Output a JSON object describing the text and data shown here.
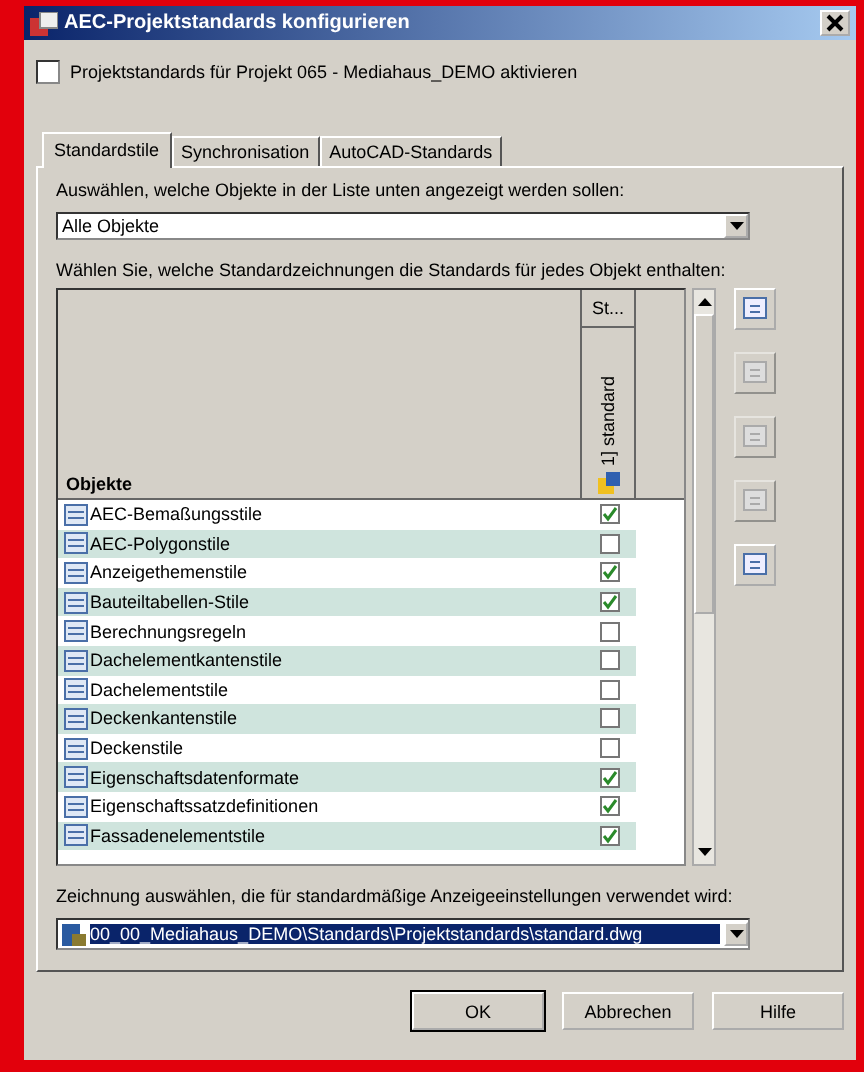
{
  "window": {
    "title": "AEC-Projektstandards konfigurieren"
  },
  "enable_checkbox": {
    "label": "Projektstandards für Projekt 065 - Mediahaus_DEMO aktivieren",
    "checked": false
  },
  "tabs": [
    {
      "label": "Standardstile",
      "selected": true
    },
    {
      "label": "Synchronisation",
      "selected": false
    },
    {
      "label": "AutoCAD-Standards",
      "selected": false
    }
  ],
  "filter": {
    "label": "Auswählen, welche Objekte in der Liste unten angezeigt werden sollen:",
    "value": "Alle Objekte"
  },
  "table": {
    "label": "Wählen Sie, welche Standardzeichnungen die Standards für jedes Objekt enthalten:",
    "columns": [
      "Objekte",
      "St..."
    ],
    "drawing_column": "1] standard",
    "rows": [
      {
        "name": "AEC-Bemaßungsstile",
        "checked": true
      },
      {
        "name": "AEC-Polygonstile",
        "checked": false
      },
      {
        "name": "Anzeigethemenstile",
        "checked": true
      },
      {
        "name": "Bauteiltabellen-Stile",
        "checked": true
      },
      {
        "name": "Berechnungsregeln",
        "checked": false
      },
      {
        "name": "Dachelementkantenstile",
        "checked": false
      },
      {
        "name": "Dachelementstile",
        "checked": false
      },
      {
        "name": "Deckenkantenstile",
        "checked": false
      },
      {
        "name": "Deckenstile",
        "checked": false
      },
      {
        "name": "Eigenschaftsdatenformate",
        "checked": true
      },
      {
        "name": "Eigenschaftssatzdefinitionen",
        "checked": true
      },
      {
        "name": "Fassadenelementstile",
        "checked": true
      }
    ]
  },
  "side_buttons": [
    {
      "disabled": false
    },
    {
      "disabled": true
    },
    {
      "disabled": true
    },
    {
      "disabled": true
    },
    {
      "disabled": false
    }
  ],
  "default_drawing": {
    "label": "Zeichnung auswählen, die für standardmäßige Anzeigeeinstellungen verwendet wird:",
    "value": "00_00_Mediahaus_DEMO\\Standards\\Projektstandards\\standard.dwg"
  },
  "buttons": [
    "OK",
    "Abbrechen",
    "Hilfe"
  ]
}
